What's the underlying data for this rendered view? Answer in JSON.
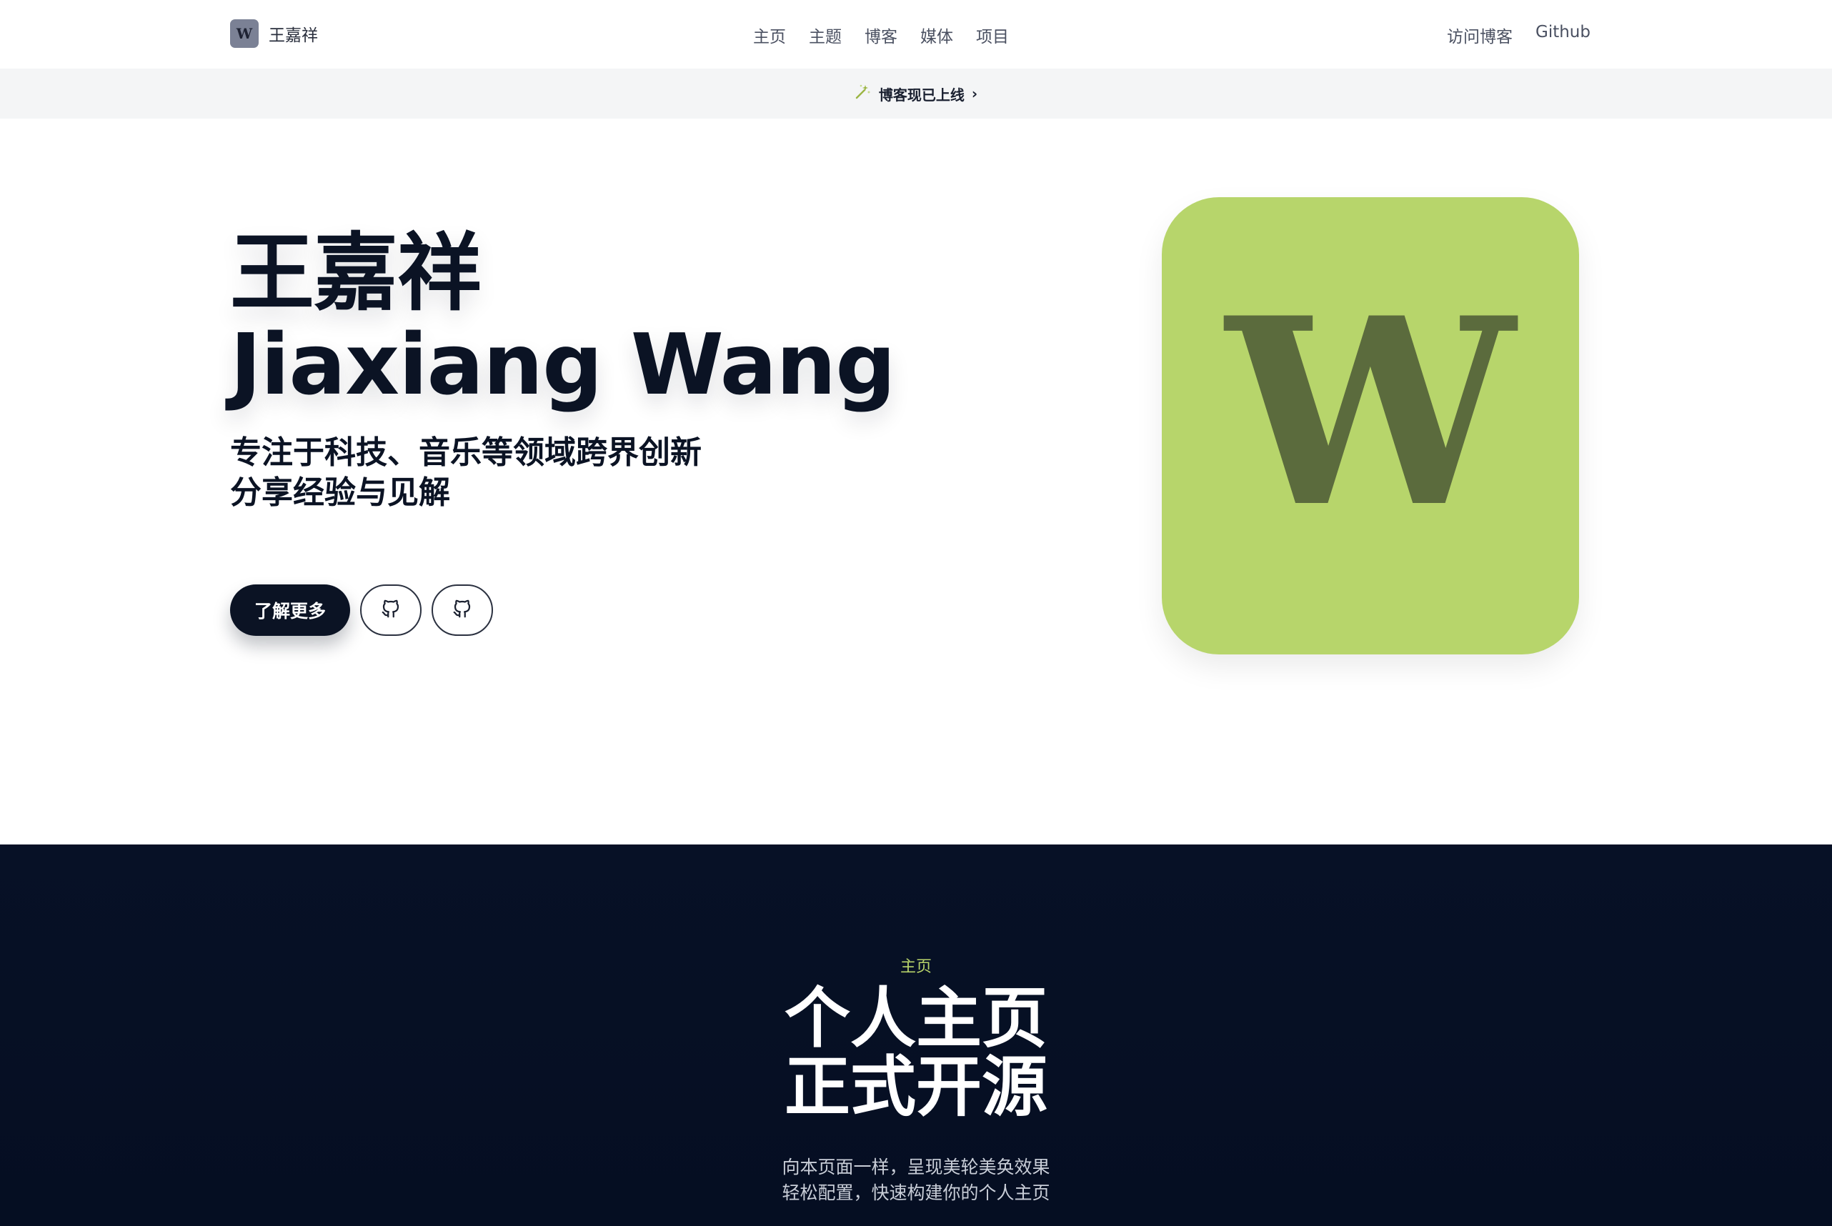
{
  "header": {
    "brand_logo_letter": "W",
    "brand_name": "王嘉祥",
    "nav": [
      "主页",
      "主题",
      "博客",
      "媒体",
      "项目"
    ],
    "right_links": [
      "访问博客",
      "Github"
    ]
  },
  "announcement": {
    "icon": "sparkle-icon",
    "text": "博客现已上线",
    "chevron": "›"
  },
  "hero": {
    "title_line1": "王嘉祥",
    "title_line2": "Jiaxiang Wang",
    "subtitle_line1": "专注于科技、音乐等领域跨界创新",
    "subtitle_line2": "分享经验与见解",
    "primary_button": "了解更多",
    "icon_buttons": [
      "github-icon",
      "github-icon"
    ],
    "card_letter": "W",
    "card_color": "#b7d56b"
  },
  "section": {
    "eyebrow": "主页",
    "title_line1": "个人主页",
    "title_line2": "正式开源",
    "desc_line1": "向本页面一样，呈现美轮美奂效果",
    "desc_line2": "轻松配置，快速构建你的个人主页"
  },
  "colors": {
    "accent": "#b8d46a",
    "dark_bg": "#071126",
    "text_primary": "#0b1324"
  }
}
